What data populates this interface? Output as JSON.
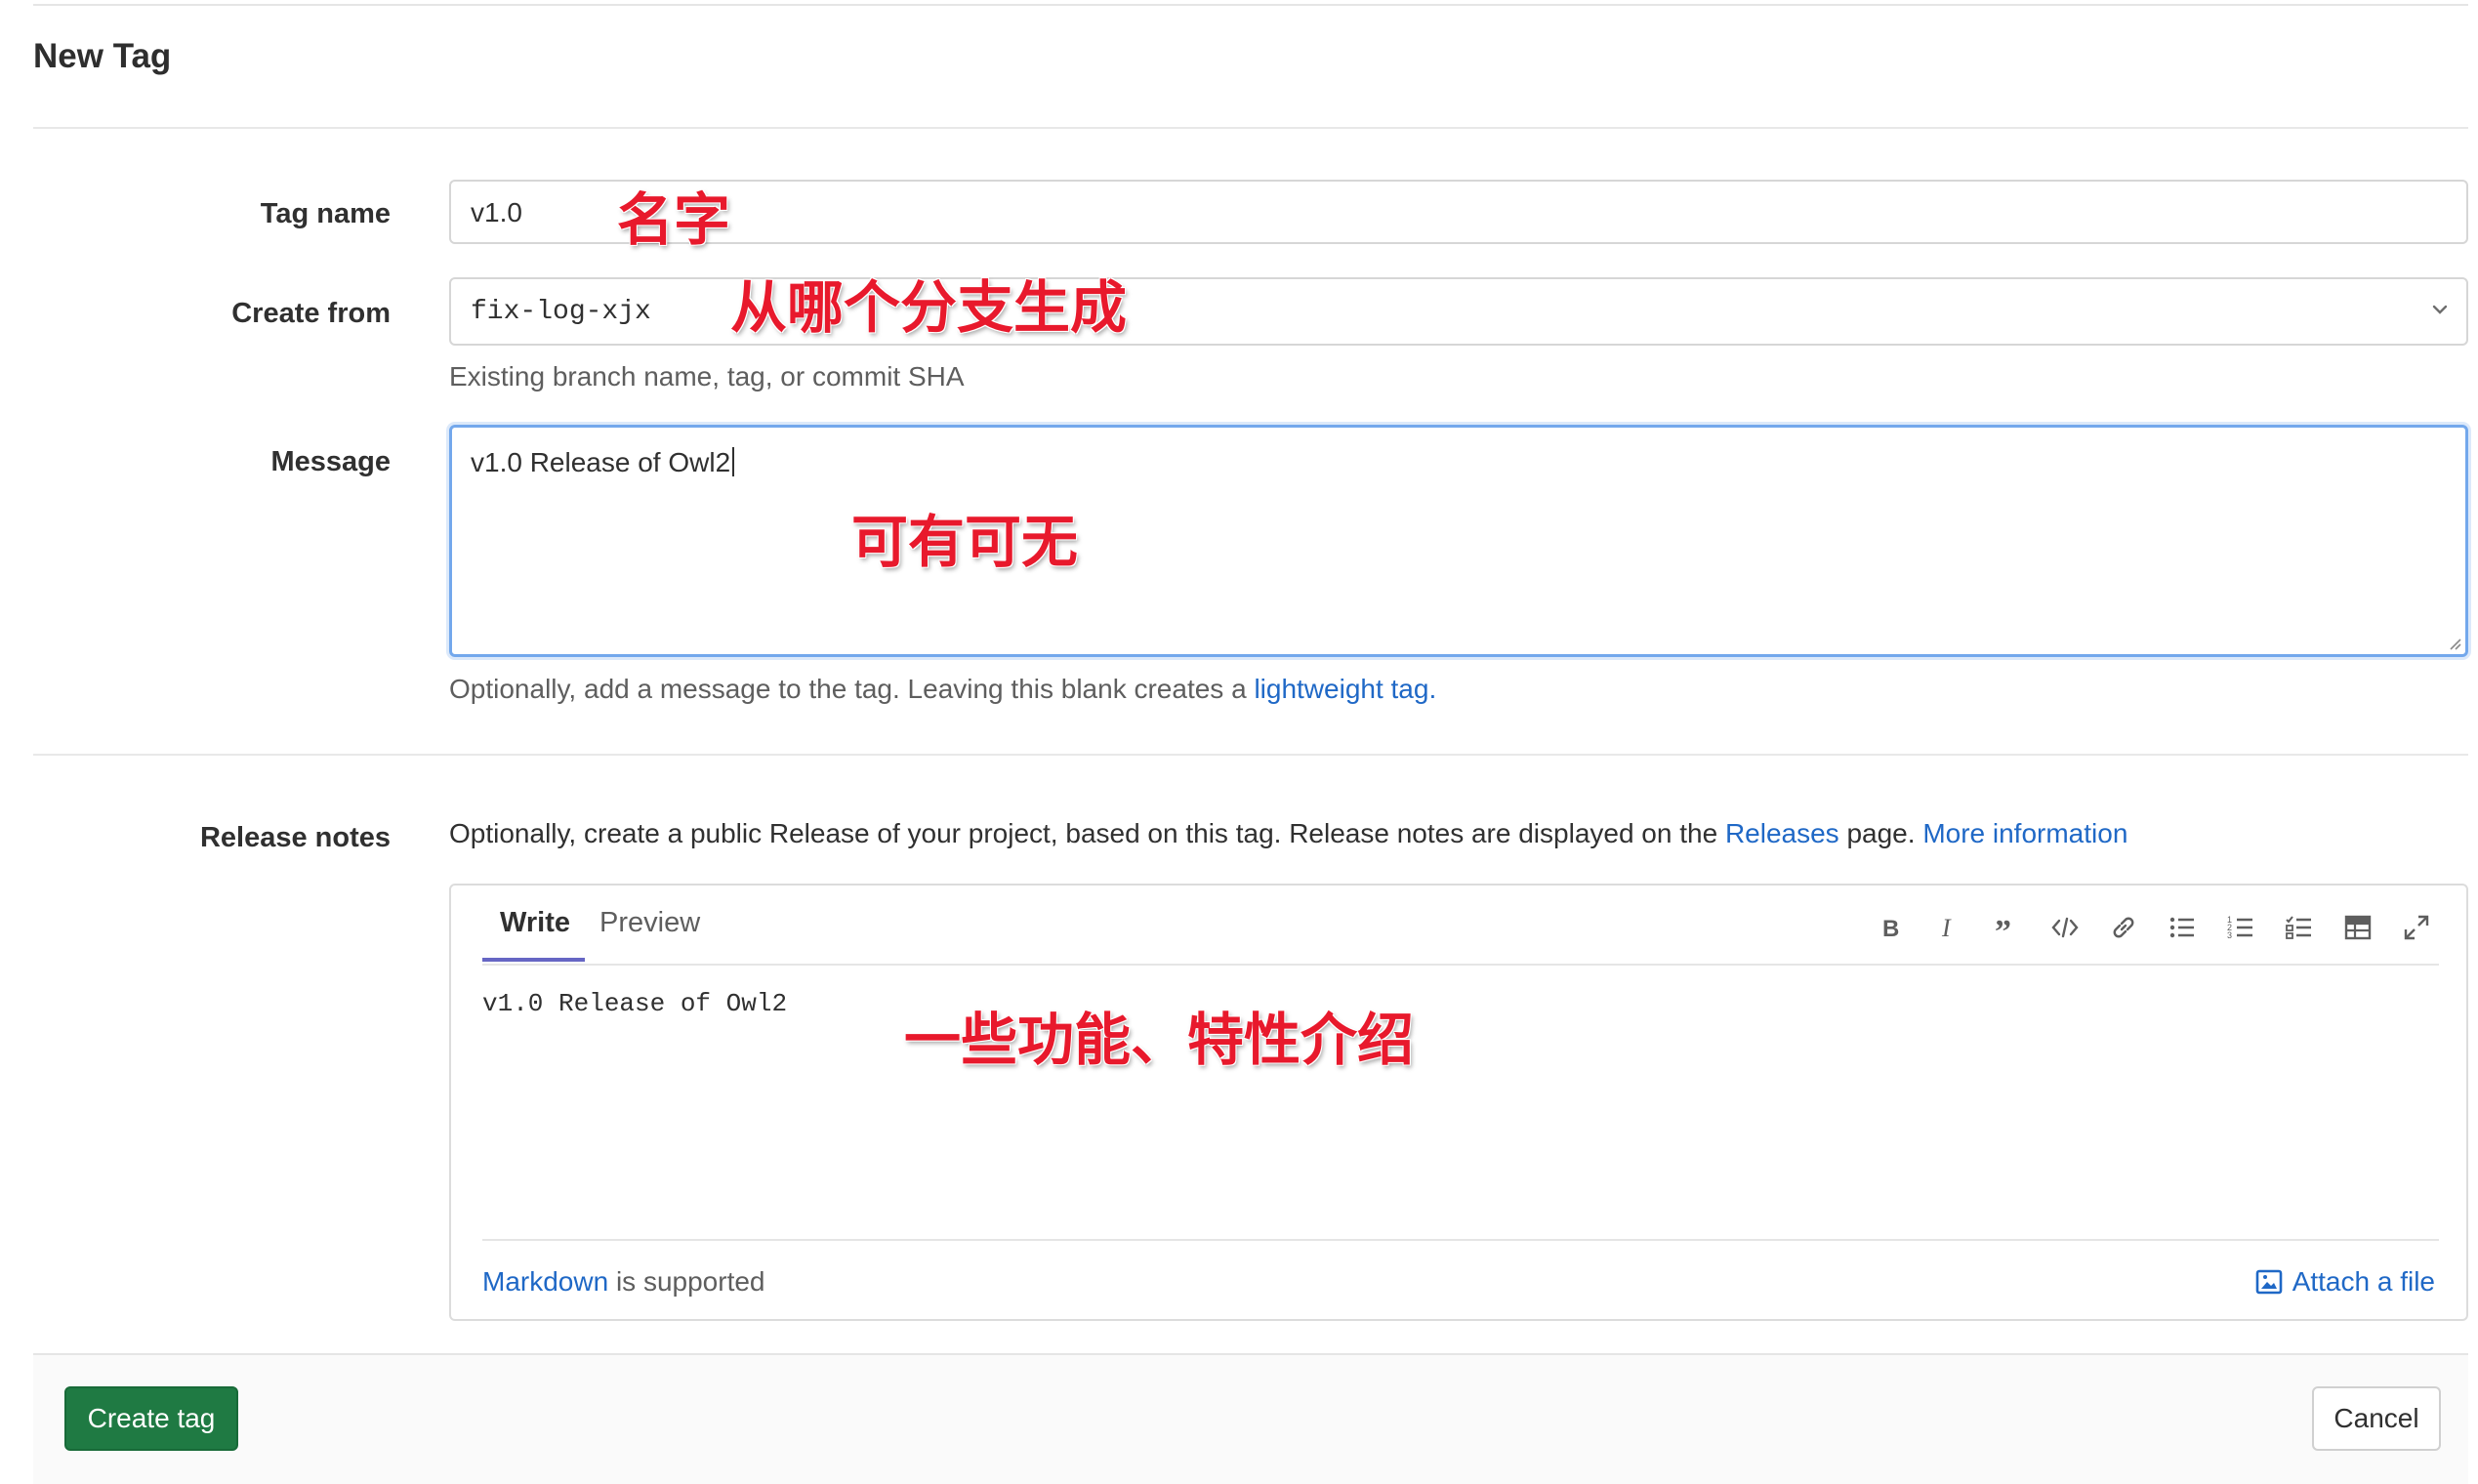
{
  "page": {
    "title": "New Tag"
  },
  "tag_name": {
    "label": "Tag name",
    "value": "v1.0",
    "annotation": "名字"
  },
  "create_from": {
    "label": "Create from",
    "value": "fix-log-xjx",
    "annotation": "从哪个分支生成",
    "help": "Existing branch name, tag, or commit SHA"
  },
  "message": {
    "label": "Message",
    "value": "v1.0 Release of Owl2",
    "annotation": "可有可无",
    "help_prefix": "Optionally, add a message to the tag. Leaving this blank creates a ",
    "help_link": "lightweight tag."
  },
  "release_notes": {
    "label": "Release notes",
    "description_prefix": "Optionally, create a public Release of your project, based on this tag. Release notes are displayed on the ",
    "releases_link": "Releases",
    "description_mid": " page. ",
    "more_info_link": "More information",
    "tabs": {
      "write": "Write",
      "preview": "Preview"
    },
    "toolbar": [
      "bold-icon",
      "italic-icon",
      "quote-icon",
      "code-icon",
      "link-icon",
      "bullet-list-icon",
      "numbered-list-icon",
      "task-list-icon",
      "table-icon",
      "fullscreen-icon"
    ],
    "content": "v1.0 Release of Owl2",
    "annotation": "一些功能、特性介绍",
    "markdown_link": "Markdown",
    "markdown_suffix": " is supported",
    "attach_label": "Attach a file"
  },
  "actions": {
    "create": "Create tag",
    "cancel": "Cancel"
  },
  "colors": {
    "primary_green": "#1f7a43",
    "link_blue": "#1f68c6",
    "annotation_red": "#e8192c",
    "tab_underline": "#6666c4"
  }
}
